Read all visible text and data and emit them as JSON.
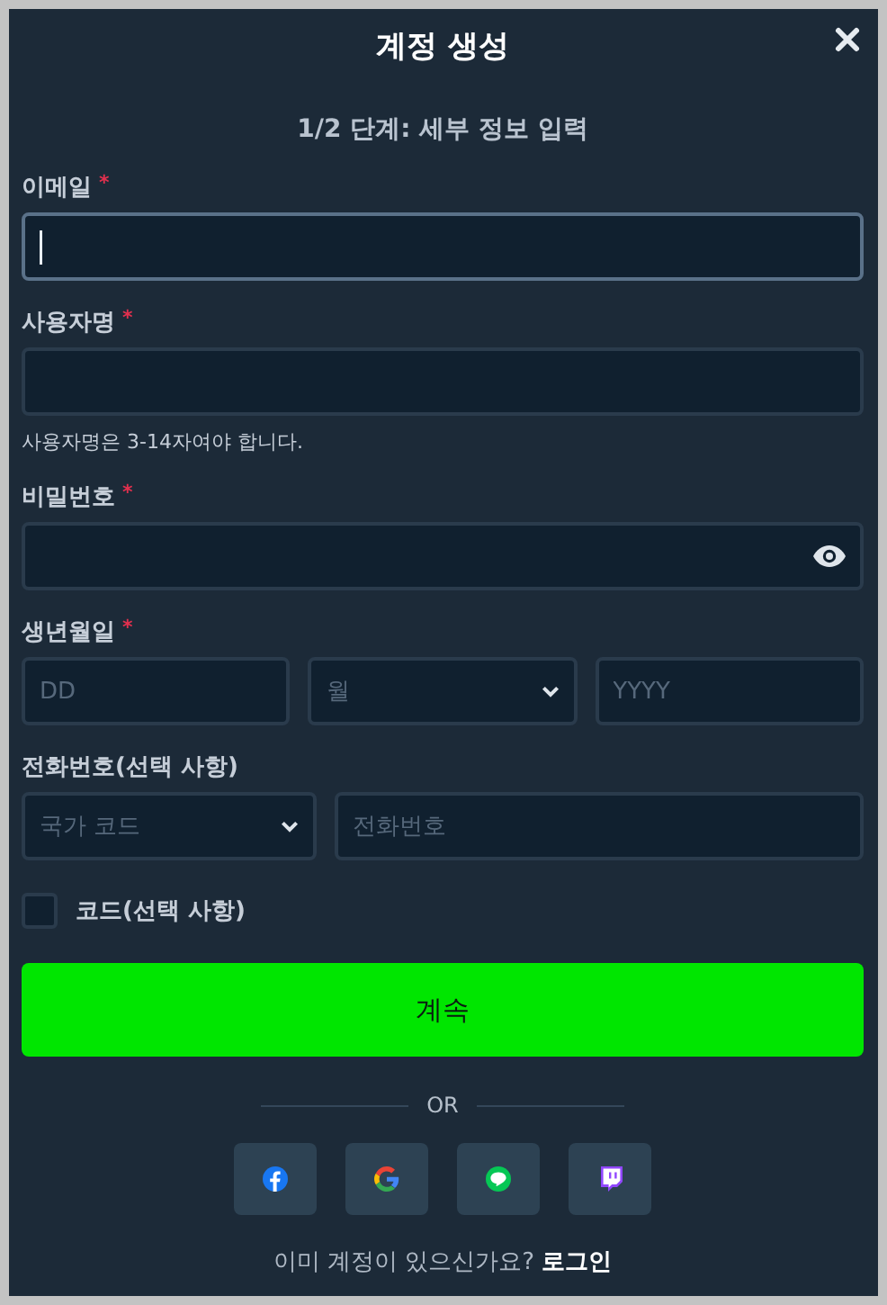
{
  "title": "계정 생성",
  "step": "1/2 단계: 세부 정보 입력",
  "fields": [
    {
      "label": "이메일",
      "mark": "*",
      "parts": [
        {
          "kind": "input",
          "focused": true
        }
      ]
    },
    {
      "label": "사용자명",
      "mark": "*",
      "parts": [
        {
          "kind": "input",
          "focused": false
        }
      ],
      "hint": "사용자명은 3-14자여야 합니다."
    },
    {
      "label": "비밀번호",
      "mark": "*",
      "parts": [
        {
          "kind": "password",
          "focused": false
        }
      ]
    },
    {
      "label": "생년월일",
      "mark": "*",
      "parts": [
        {
          "kind": "input",
          "placeholder": "DD",
          "focused": false
        },
        {
          "kind": "select",
          "placeholder": "월",
          "focused": false
        },
        {
          "kind": "input",
          "placeholder": "YYYY",
          "focused": false
        }
      ]
    },
    {
      "label": "전화번호(선택 사항)",
      "parts": [
        {
          "kind": "select",
          "placeholder": "국가 코드",
          "focused": false
        },
        {
          "kind": "input",
          "placeholder": "전화번호",
          "focused": false,
          "wide": true
        }
      ]
    }
  ],
  "checkbox": {
    "label": "코드(선택 사항)",
    "checked": false
  },
  "submit": "계속",
  "divider": "OR",
  "socials": [
    {
      "kind": "facebook"
    },
    {
      "kind": "google"
    },
    {
      "kind": "line"
    },
    {
      "kind": "twitch"
    }
  ],
  "footer": {
    "text": "이미 계정이 있으신가요?",
    "link": "로그인"
  }
}
